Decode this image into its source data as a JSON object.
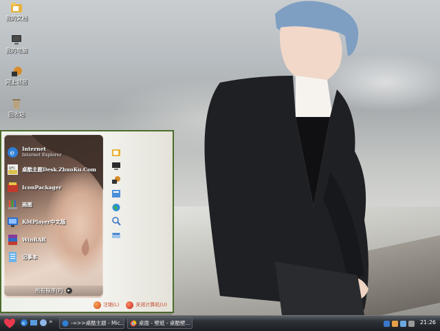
{
  "desktop": {
    "icons": [
      {
        "label": "我的文档",
        "icon": "folder-icon"
      },
      {
        "label": "我的电脑",
        "icon": "computer-icon"
      },
      {
        "label": "网上邻居",
        "icon": "network-icon"
      },
      {
        "label": "回收站",
        "icon": "recycle-bin-icon"
      }
    ]
  },
  "start_menu": {
    "items": [
      {
        "title": "Internet",
        "subtitle": "Internet Explorer",
        "icon": "ie-icon"
      },
      {
        "title": "桌酷主题Desk.ZhuoKu.Com",
        "subtitle": "",
        "icon": "zhuoku-icon"
      },
      {
        "title": "IconPackager",
        "subtitle": "",
        "icon": "iconpackager-icon"
      },
      {
        "title": "画图",
        "subtitle": "",
        "icon": "paint-icon"
      },
      {
        "title": "KMPlayer中文版",
        "subtitle": "",
        "icon": "kmplayer-icon"
      },
      {
        "title": "WinRAR",
        "subtitle": "",
        "icon": "winrar-icon"
      },
      {
        "title": "记事本",
        "subtitle": "",
        "icon": "notepad-icon"
      }
    ],
    "all_programs": "所有程序(P)",
    "right_icons": [
      "documents-icon",
      "computer-icon",
      "network-icon",
      "control-panel-icon",
      "globe-icon",
      "search-icon",
      "run-icon"
    ],
    "logoff": "注销(L)",
    "shutdown": "关闭计算机(U)"
  },
  "taskbar": {
    "tasks": [
      {
        "label": "-=>>桌酷主题 - Mic...",
        "icon": "ie-task-icon"
      },
      {
        "label": "桌面 - 壁纸 - 桌酷壁...",
        "icon": "chrome-task-icon"
      }
    ],
    "clock": "21:26"
  },
  "colors": {
    "menu_border": "#4b6a2a",
    "taskbar": "#1b1e22",
    "shutdown_red": "#c4462a"
  }
}
